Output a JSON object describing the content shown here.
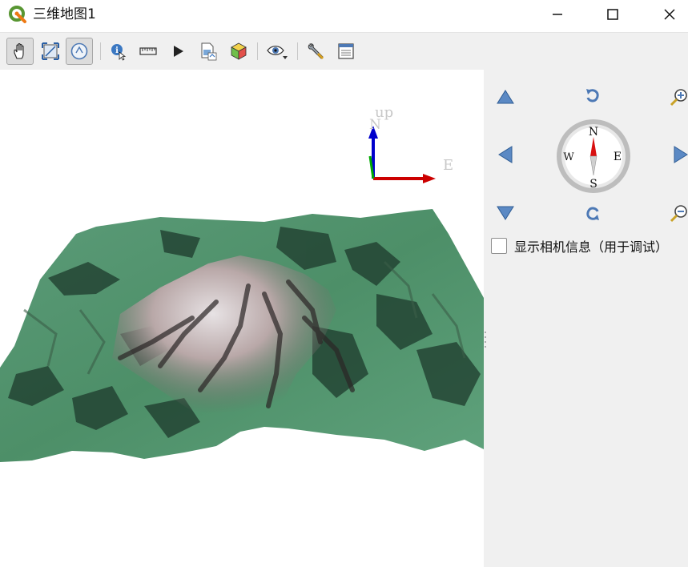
{
  "window": {
    "title": "三维地图1",
    "controls": [
      "minimize",
      "maximize",
      "close"
    ]
  },
  "toolbar": {
    "buttons": [
      {
        "icon": "pan-hand-icon",
        "active": true
      },
      {
        "icon": "zoom-full-icon",
        "active": false
      },
      {
        "icon": "camera-control-icon",
        "active": true
      },
      {
        "icon": "identify-icon",
        "active": false
      },
      {
        "icon": "measure-ruler-icon",
        "active": false
      },
      {
        "icon": "play-animation-icon",
        "active": false
      },
      {
        "icon": "export-image-icon",
        "active": false
      },
      {
        "icon": "3d-object-icon",
        "active": false
      },
      {
        "icon": "view-eye-icon",
        "active": false
      },
      {
        "icon": "configure-wrench-icon",
        "active": false
      },
      {
        "icon": "toggle-panel-icon",
        "active": false
      }
    ]
  },
  "axes": {
    "up_label": "up",
    "north_label": "N",
    "east_label": "E",
    "colors": {
      "x": "#cc0000",
      "y": "#0000cc",
      "z": "#00aa00"
    }
  },
  "navigation": {
    "compass": {
      "north": "N",
      "south": "S",
      "east": "E",
      "west": "W"
    },
    "debug_checkbox": {
      "label": "显示相机信息（用于调试）",
      "checked": false
    }
  },
  "colors": {
    "terrain_green": "#4d8f68",
    "terrain_rock": "#b9a8a8",
    "panel_bg": "#f0f0f0",
    "nav_arrow": "#5b89c4"
  }
}
